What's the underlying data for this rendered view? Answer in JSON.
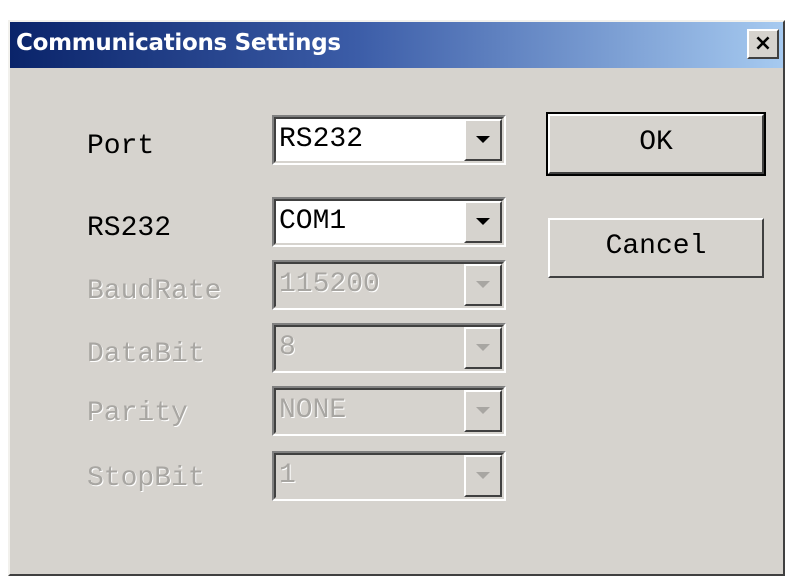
{
  "dialog": {
    "title": "Communications Settings",
    "close_symbol": "×"
  },
  "fields": [
    {
      "label": "Port",
      "value": "RS232",
      "enabled": true
    },
    {
      "label": "RS232",
      "value": "COM1",
      "enabled": true
    },
    {
      "label": "BaudRate",
      "value": "115200",
      "enabled": false
    },
    {
      "label": "DataBit",
      "value": "8",
      "enabled": false
    },
    {
      "label": "Parity",
      "value": "NONE",
      "enabled": false
    },
    {
      "label": "StopBit",
      "value": "1",
      "enabled": false
    }
  ],
  "buttons": {
    "ok": "OK",
    "cancel": "Cancel"
  },
  "icons": {
    "close": "close-icon",
    "dropdown": "chevron-down-icon"
  },
  "colors": {
    "title_bar_start": "#0a246a",
    "title_bar_end": "#a6caf0",
    "dialog_background": "#d6d3ce",
    "disabled_text": "#a8a6a2"
  }
}
